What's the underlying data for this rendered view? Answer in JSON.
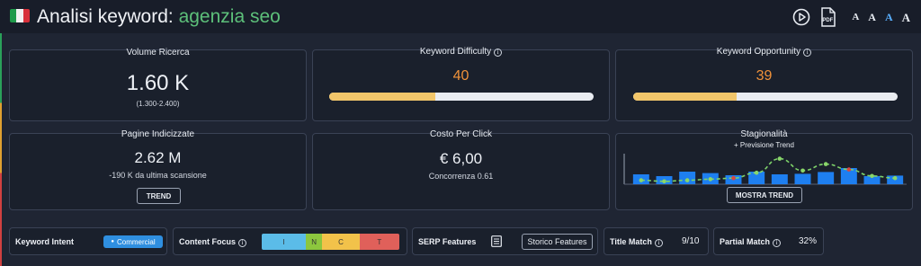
{
  "header": {
    "title_prefix": "Analisi keyword:",
    "keyword": "agenzia seo",
    "flag_colors": [
      "#1f9a4a",
      "#f2f2f2",
      "#d8303a"
    ],
    "icons": [
      "play-icon",
      "pdf-icon"
    ],
    "pdf_label": "PDF",
    "font_sizes": [
      "A",
      "A",
      "A",
      "A"
    ]
  },
  "volume": {
    "title": "Volume Ricerca",
    "value": "1.60 K",
    "range": "(1.300-2.400)"
  },
  "difficulty": {
    "title": "Keyword Difficulty",
    "value": "40",
    "progress": 0.4,
    "color": "#f0923a"
  },
  "opportunity": {
    "title": "Keyword Opportunity",
    "value": "39",
    "progress": 0.39,
    "color": "#f0923a"
  },
  "indexed": {
    "title": "Pagine Indicizzate",
    "value": "2.62 M",
    "delta": "-190 K da ultima scansione",
    "button": "TREND"
  },
  "cpc": {
    "title": "Costo Per Click",
    "value": "€ 6,00",
    "competition": "Concorrenza 0.61"
  },
  "seasonality": {
    "title": "Stagionalità",
    "subtitle": "+ Previsione Trend",
    "button": "MOSTRA TREND"
  },
  "chart_data": {
    "type": "bar",
    "values": [
      0.55,
      0.45,
      0.7,
      0.62,
      0.5,
      0.7,
      0.55,
      0.58,
      0.68,
      0.9,
      0.45,
      0.48
    ],
    "trend": [
      0.1,
      0.05,
      0.1,
      0.15,
      0.2,
      0.45,
      1.1,
      0.55,
      0.85,
      0.6,
      0.3,
      0.2
    ],
    "bar_color": "#1e7ff0",
    "trend_color": "#7ed36a",
    "trend_dot_colors": [
      "#8ad66a",
      "#8ad66a",
      "#8ad66a",
      "#8ad66a",
      "#d9473f",
      "#8ad66a",
      "#8ad66a",
      "#8ad66a",
      "#8ad66a",
      "#d9473f",
      "#8ad66a",
      "#8ad66a"
    ]
  },
  "intent": {
    "label": "Keyword Intent",
    "badge": "Commercial"
  },
  "content_focus": {
    "label": "Content Focus",
    "segments": [
      {
        "label": "I",
        "color": "#5bbce8",
        "share": 0.32
      },
      {
        "label": "N",
        "color": "#8cc63e",
        "share": 0.12
      },
      {
        "label": "C",
        "color": "#f2c24a",
        "share": 0.27
      },
      {
        "label": "T",
        "color": "#e0605a",
        "share": 0.29
      }
    ]
  },
  "serp": {
    "label": "SERP Features",
    "button": "Storico Features"
  },
  "title_match": {
    "label": "Title Match",
    "value": "9/10"
  },
  "partial_match": {
    "label": "Partial Match",
    "value": "32%"
  }
}
